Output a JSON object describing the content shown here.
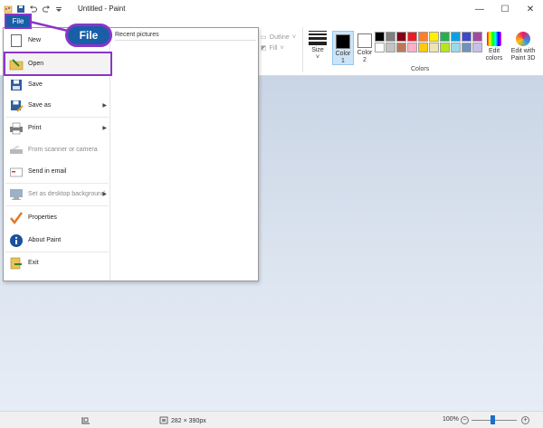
{
  "window": {
    "title": "Untitled - Paint",
    "minimize": "—",
    "maximize": "☐",
    "close": "✕"
  },
  "ribbon": {
    "outline_label": "Outline",
    "fill_label": "Fill",
    "size_label": "Size",
    "color1_label": "Color",
    "color1_num": "1",
    "color2_label": "Color",
    "color2_num": "2",
    "color1_value": "#000000",
    "color2_value": "#ffffff",
    "colors_group_label": "Colors",
    "edit_colors_label_1": "Edit",
    "edit_colors_label_2": "colors",
    "edit3d_label_1": "Edit with",
    "edit3d_label_2": "Paint 3D",
    "palette": [
      "#000000",
      "#7f7f7f",
      "#880015",
      "#ed1c24",
      "#ff7f27",
      "#fff200",
      "#22b14c",
      "#00a2e8",
      "#3f48cc",
      "#a349a4",
      "#ffffff",
      "#c3c3c3",
      "#b97a57",
      "#ffaec9",
      "#ffc90e",
      "#efe4b0",
      "#b5e61d",
      "#99d9ea",
      "#7092be",
      "#c8bfe7"
    ]
  },
  "file_menu": {
    "tab_label": "File",
    "callout_label": "File",
    "recent_title": "Recent pictures",
    "items": [
      {
        "label": "New",
        "disabled": false
      },
      {
        "label": "Open",
        "disabled": false
      },
      {
        "label": "Save",
        "disabled": false
      },
      {
        "label": "Save as",
        "disabled": false,
        "submenu": true
      },
      {
        "label": "Print",
        "disabled": false,
        "submenu": true
      },
      {
        "label": "From scanner or camera",
        "disabled": true
      },
      {
        "label": "Send in email",
        "disabled": false
      },
      {
        "label": "Set as desktop background",
        "disabled": true,
        "submenu": true
      },
      {
        "label": "Properties",
        "disabled": false
      },
      {
        "label": "About Paint",
        "disabled": false
      },
      {
        "label": "Exit",
        "disabled": false
      }
    ]
  },
  "statusbar": {
    "dimensions": "282 × 390px",
    "zoom": "100%",
    "zoom_out": "−",
    "zoom_in": "+"
  },
  "accent": "#8a35c9"
}
